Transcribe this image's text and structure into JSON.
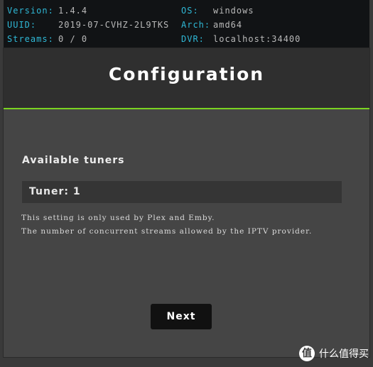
{
  "info": {
    "version_label": "Version:",
    "version_value": "1.4.4",
    "uuid_label": "UUID:",
    "uuid_value": "2019-07-CVHZ-2L9TKS",
    "streams_label": "Streams:",
    "streams_value": "0 / 0",
    "os_label": "OS:",
    "os_value": "windows",
    "arch_label": "Arch:",
    "arch_value": "amd64",
    "dvr_label": "DVR:",
    "dvr_value": "localhost:34400"
  },
  "header": {
    "title": "Configuration",
    "accent_color": "#7bd321"
  },
  "form": {
    "section_title": "Available tuners",
    "tuner_value": "Tuner: 1",
    "help_line_1": "This setting is only used by Plex and Emby.",
    "help_line_2": "The number of concurrent streams allowed by the IPTV provider."
  },
  "actions": {
    "next_label": "Next"
  },
  "watermark": {
    "logo_glyph": "值",
    "text": "什么值得买"
  }
}
